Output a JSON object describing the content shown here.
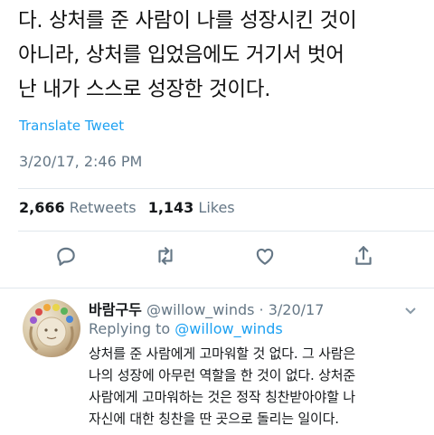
{
  "tweet": {
    "lines": [
      "다. 상처를 준 사람이 나를 성장시킨 것이",
      "아니라, 상처를 입었음에도 거기서 벗어",
      "난 내가 스스로 성장한 것이다."
    ],
    "translate_label": "Translate Tweet",
    "timestamp": "3/20/17, 2:46 PM",
    "retweets_count": "2,666",
    "retweets_label": "Retweets",
    "likes_count": "1,143",
    "likes_label": "Likes"
  },
  "actions": {
    "icons": [
      "reply-icon",
      "retweet-icon",
      "like-icon",
      "share-icon"
    ]
  },
  "reply": {
    "display_name": "바람구두",
    "handle": "@willow_winds",
    "separator": " · ",
    "date": "3/20/17",
    "replying_prefix": "Replying to ",
    "replying_to": "@willow_winds",
    "lines": [
      "상처를 준 사람에게 고마워할 것 없다. 그 사람은",
      "나의 성장에 아무런 역할을 한 것이 없다. 상처준",
      "사람에게 고마워하는 것은 정작 칭찬받아야할 나",
      "자신에 대한 칭찬을 딴 곳으로 돌리는 일이다."
    ]
  },
  "colors": {
    "link": "#1da1f2",
    "muted": "#657786",
    "text": "#14171a",
    "divider": "#e1e8ed"
  }
}
